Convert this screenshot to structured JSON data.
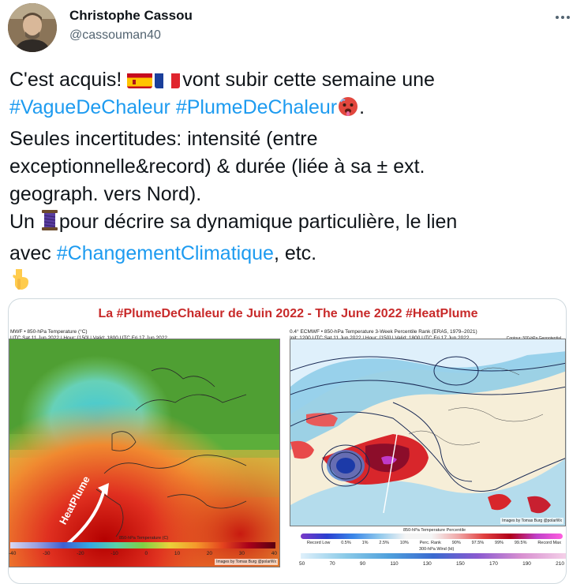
{
  "author": {
    "name": "Christophe Cassou",
    "handle": "@cassouman40"
  },
  "tweet": {
    "line1_prefix": "C'est acquis! ",
    "line1_suffix": "vont subir cette semaine une",
    "hashtag1": "#VagueDeChaleur",
    "hashtag2": "#PlumeDeChaleur",
    "line2_suffix": ".",
    "line3": "Seules incertitudes: intensité (entre",
    "line4": "exceptionnelle&record) & durée (liée à sa ± ext.",
    "line5": "geograph. vers Nord).",
    "line6_prefix": "Un ",
    "line6_suffix": "pour décrire sa dynamique particulière, le lien",
    "line7_prefix": "avec ",
    "hashtag3": "#ChangementClimatique",
    "line7_suffix": ", etc.",
    "emoji_names": [
      "flag-spain",
      "flag-france",
      "hot-face-emoji",
      "thread-emoji",
      "pointing-down-emoji"
    ]
  },
  "media": {
    "title": "La #PlumeDeChaleur de Juin 2022 - The June 2022 #HeatPlume",
    "left_map": {
      "header_line1": "MWF • 850-hPa Temperature (°C)",
      "header_line2": "UTC Sat 11 Jun 2022 | Hour: [150] | Valid: 1800 UTC Fri 17 Jun 2022",
      "credit": "Images by Tomas Burg @polarWx",
      "arrow_label": "HeatPlume",
      "colorbar_title": "850-hPa Temperature (C)",
      "ticks": [
        "-40",
        "-30",
        "-20",
        "-10",
        "0",
        "10",
        "20",
        "30",
        "40"
      ]
    },
    "right_map": {
      "header_line1": "0.4° ECMWF • 850-hPa Temperature 3-Week Percentile Rank (ERA5, 1979–2021)",
      "header_line2": "Init: 1200 UTC Sat 11 Jun 2022 | Hour: [150] | Valid: 1800 UTC Fri 17 Jun 2022",
      "header_right": "Contour: 500-hPa Geopotential",
      "credit": "Images by Tomas Burg @polarWx",
      "percentile_title": "850-hPa Temperature Percentile",
      "percentile_ticks": [
        "Record Low",
        "0.5%",
        "1%",
        "2.5%",
        "10%",
        "Perc. Rank",
        "90%",
        "97.5%",
        "99%",
        "99.5%",
        "Record Max"
      ],
      "wind_title": "300-hPa Wind (kt)",
      "wind_ticks": [
        "50",
        "70",
        "90",
        "110",
        "130",
        "150",
        "170",
        "190",
        "210"
      ]
    }
  },
  "colors": {
    "hashtag": "#1d9bf0",
    "title_red": "#c82a2a",
    "handle_gray": "#536471"
  }
}
